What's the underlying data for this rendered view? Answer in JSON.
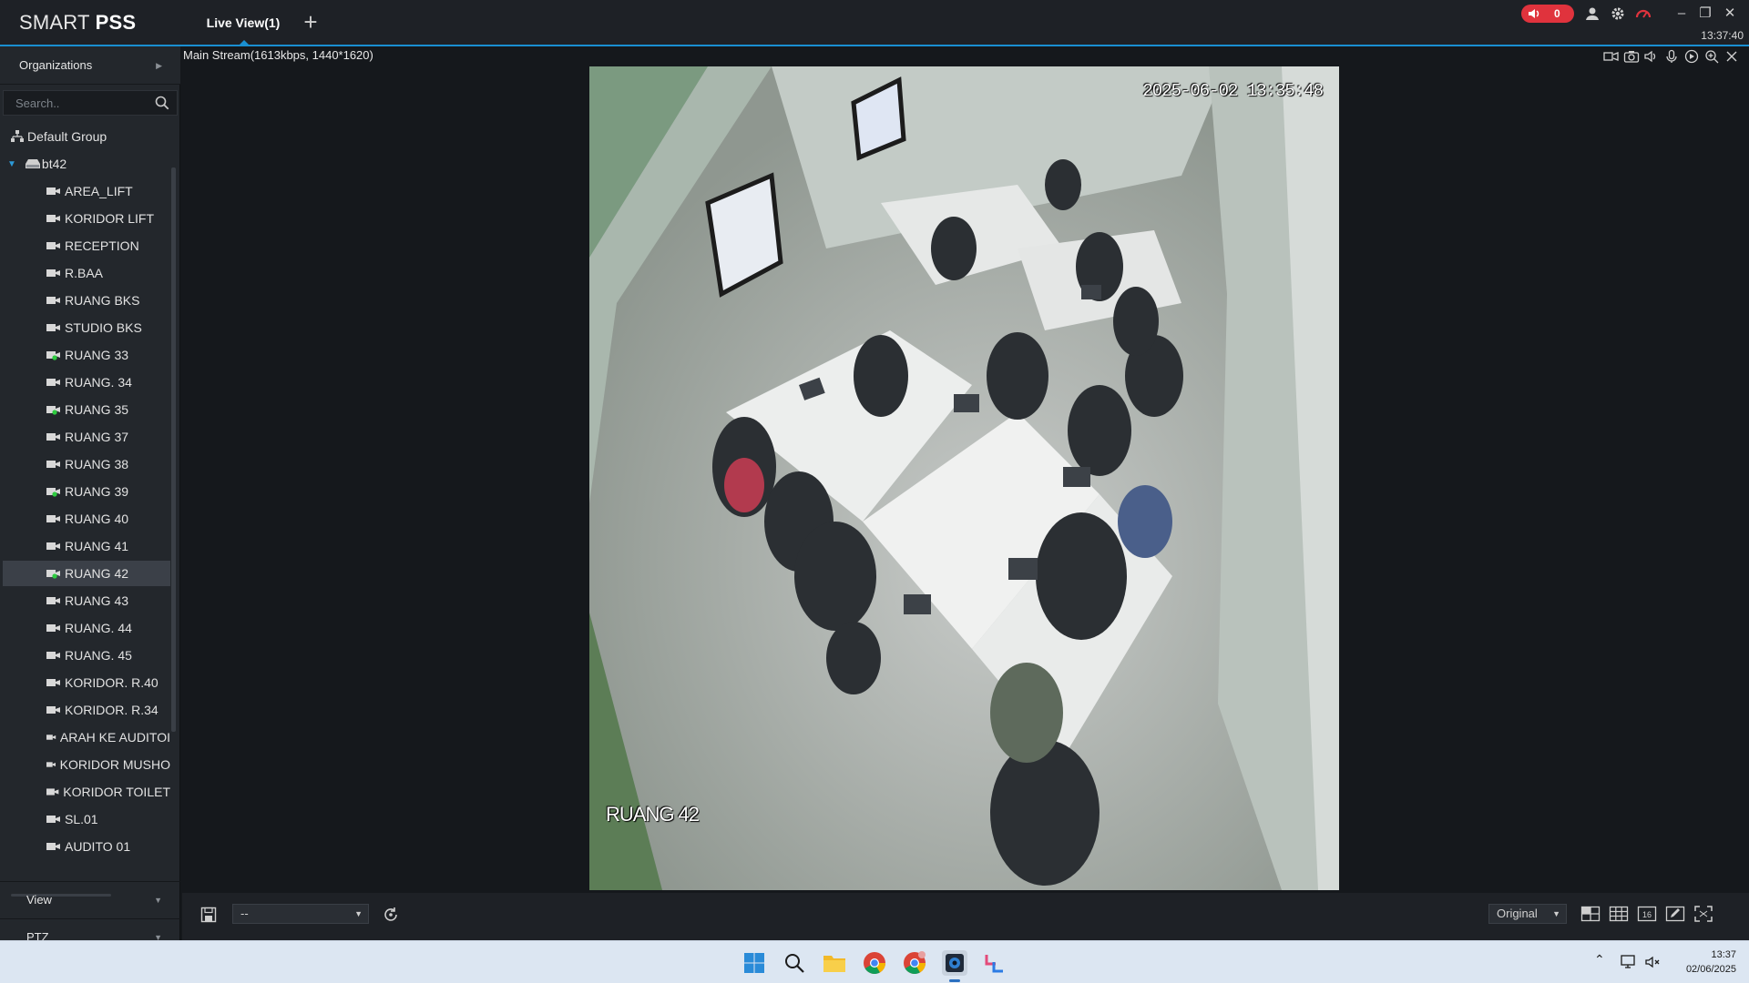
{
  "app": {
    "brand_light": "SMART",
    "brand_bold": "PSS",
    "tab_label": "Live View(1)",
    "add_tab": "+",
    "alarm_count": "0",
    "time_top": "13:37:40",
    "colors": {
      "accent": "#1a8fd1",
      "alarm": "#e0333d",
      "online": "#2ecc40"
    }
  },
  "sidebar": {
    "organizations_label": "Organizations",
    "search_placeholder": "Search..",
    "group_label": "Default Group",
    "device_label": "bt42",
    "cameras": [
      {
        "label": "AREA_LIFT",
        "online": false
      },
      {
        "label": "KORIDOR LIFT",
        "online": false
      },
      {
        "label": "RECEPTION",
        "online": false
      },
      {
        "label": "R.BAA",
        "online": false
      },
      {
        "label": "RUANG BKS",
        "online": false
      },
      {
        "label": "STUDIO BKS",
        "online": false
      },
      {
        "label": "RUANG 33",
        "online": true
      },
      {
        "label": "RUANG. 34",
        "online": false
      },
      {
        "label": "RUANG 35",
        "online": true
      },
      {
        "label": "RUANG  37",
        "online": false
      },
      {
        "label": "RUANG 38",
        "online": false
      },
      {
        "label": "RUANG 39",
        "online": true
      },
      {
        "label": "RUANG 40",
        "online": false
      },
      {
        "label": "RUANG 41",
        "online": false
      },
      {
        "label": "RUANG 42",
        "online": true,
        "selected": true
      },
      {
        "label": "RUANG 43",
        "online": false
      },
      {
        "label": "RUANG. 44",
        "online": false
      },
      {
        "label": "RUANG. 45",
        "online": false
      },
      {
        "label": "KORIDOR. R.40",
        "online": false
      },
      {
        "label": "KORIDOR. R.34",
        "online": false
      },
      {
        "label": "ARAH KE AUDITOI",
        "online": false
      },
      {
        "label": "KORIDOR MUSHO",
        "online": false
      },
      {
        "label": "KORIDOR TOILET",
        "online": false
      },
      {
        "label": "SL.01",
        "online": false
      },
      {
        "label": "AUDITO 01",
        "online": false
      }
    ],
    "view_label": "View",
    "ptz_label": "PTZ"
  },
  "video": {
    "stream_info": "Main Stream(1613kbps, 1440*1620)",
    "timestamp": "2025-06-02 13:35:48",
    "camera_label": "RUANG 42"
  },
  "bottombar": {
    "select_value": "--",
    "ratio_value": "Original"
  },
  "taskbar": {
    "time": "13:37",
    "date": "02/06/2025"
  }
}
